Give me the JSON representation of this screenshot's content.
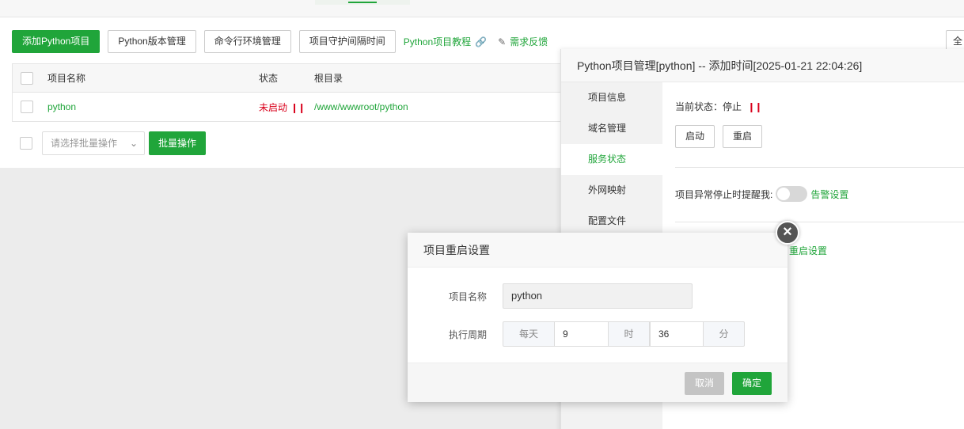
{
  "toolbar": {
    "add_project": "添加Python项目",
    "version_mgmt": "Python版本管理",
    "cli_env": "命令行环境管理",
    "guard_interval": "项目守护间隔时间",
    "tutorial": "Python项目教程",
    "feedback": "需求反馈",
    "right_btn": "全"
  },
  "table": {
    "headers": {
      "name": "项目名称",
      "status": "状态",
      "root": "根目录"
    },
    "rows": [
      {
        "name": "python",
        "status": "未启动",
        "root": "/www/wwwroot/python"
      }
    ]
  },
  "batch": {
    "select_placeholder": "请选择批量操作",
    "button": "批量操作"
  },
  "project_panel": {
    "title": "Python项目管理[python] -- 添加时间[2025-01-21 22:04:26]",
    "menu": [
      "项目信息",
      "域名管理",
      "服务状态",
      "外网映射",
      "配置文件"
    ],
    "active_menu": "服务状态",
    "current_status": "当前状态：停止",
    "start": "启动",
    "restart": "重启",
    "alert_label": "项目异常停止时提醒我:",
    "alert_link": "告警设置",
    "restart_setting_link": "重启设置"
  },
  "modal": {
    "title": "项目重启设置",
    "name_label": "项目名称",
    "name_value": "python",
    "cycle_label": "执行周期",
    "period": "每天",
    "hour_value": "9",
    "hour_unit": "时",
    "minute_value": "36",
    "minute_unit": "分",
    "cancel": "取消",
    "ok": "确定"
  },
  "colors": {
    "accent": "#20a53a",
    "danger": "#d9001b"
  },
  "icons": [
    "link-icon",
    "edit-icon",
    "pause-icon",
    "chevron-down-icon",
    "close-icon"
  ]
}
